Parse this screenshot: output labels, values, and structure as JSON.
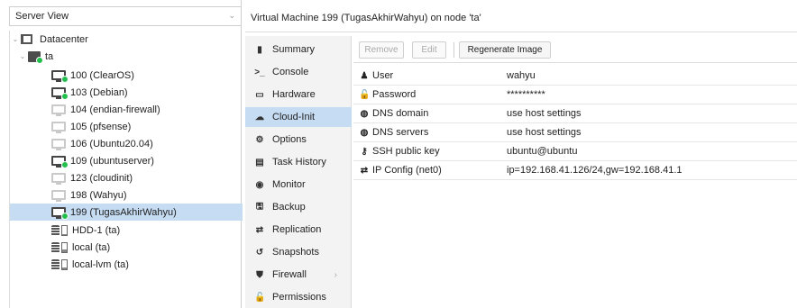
{
  "left": {
    "server_view": "Server View",
    "tree": [
      {
        "label": "Datacenter",
        "icon": "datacenter-icon"
      },
      {
        "label": "ta",
        "icon": "node-icon"
      },
      {
        "label": "100 (ClearOS)",
        "icon": "vm-running-icon"
      },
      {
        "label": "103 (Debian)",
        "icon": "vm-running-icon"
      },
      {
        "label": "104 (endian-firewall)",
        "icon": "vm-stopped-icon"
      },
      {
        "label": "105 (pfsense)",
        "icon": "vm-stopped-icon"
      },
      {
        "label": "106 (Ubuntu20.04)",
        "icon": "vm-stopped-icon"
      },
      {
        "label": "109 (ubuntuserver)",
        "icon": "vm-running-icon"
      },
      {
        "label": "123 (cloudinit)",
        "icon": "vm-stopped-icon"
      },
      {
        "label": "198 (Wahyu)",
        "icon": "vm-stopped-icon"
      },
      {
        "label": "199 (TugasAkhirWahyu)",
        "icon": "vm-running-icon"
      },
      {
        "label": "HDD-1 (ta)",
        "icon": "storage-icon"
      },
      {
        "label": "local (ta)",
        "icon": "storage-icon"
      },
      {
        "label": "local-lvm (ta)",
        "icon": "storage-icon"
      }
    ]
  },
  "header": {
    "title": "Virtual Machine 199 (TugasAkhirWahyu) on node 'ta'"
  },
  "menu": [
    {
      "label": "Summary",
      "icon": "book-icon",
      "glyph": "▮"
    },
    {
      "label": "Console",
      "icon": "terminal-icon",
      "glyph": ">_"
    },
    {
      "label": "Hardware",
      "icon": "monitor-icon",
      "glyph": "▭"
    },
    {
      "label": "Cloud-Init",
      "icon": "cloud-icon",
      "glyph": "☁"
    },
    {
      "label": "Options",
      "icon": "gear-icon",
      "glyph": "⚙"
    },
    {
      "label": "Task History",
      "icon": "list-icon",
      "glyph": "▤"
    },
    {
      "label": "Monitor",
      "icon": "eye-icon",
      "glyph": "◉"
    },
    {
      "label": "Backup",
      "icon": "floppy-icon",
      "glyph": "🖫"
    },
    {
      "label": "Replication",
      "icon": "retweet-icon",
      "glyph": "⇄"
    },
    {
      "label": "Snapshots",
      "icon": "history-icon",
      "glyph": "↺"
    },
    {
      "label": "Firewall",
      "icon": "shield-icon",
      "glyph": "⛊"
    },
    {
      "label": "Permissions",
      "icon": "unlock-icon",
      "glyph": "🔓"
    }
  ],
  "toolbar": {
    "remove_label": "Remove",
    "edit_label": "Edit",
    "regenerate_label": "Regenerate Image"
  },
  "rows": [
    {
      "key": "User",
      "value": "wahyu",
      "icon": "user-icon",
      "glyph": "♟"
    },
    {
      "key": "Password",
      "value": "**********",
      "icon": "unlock-icon",
      "glyph": "🔓"
    },
    {
      "key": "DNS domain",
      "value": "use host settings",
      "icon": "globe-icon",
      "glyph": "◍"
    },
    {
      "key": "DNS servers",
      "value": "use host settings",
      "icon": "globe-icon",
      "glyph": "◍"
    },
    {
      "key": "SSH public key",
      "value": "ubuntu@ubuntu",
      "icon": "key-icon",
      "glyph": "⚷"
    },
    {
      "key": "IP Config (net0)",
      "value": "ip=192.168.41.126/24,gw=192.168.41.1",
      "icon": "exchange-icon",
      "glyph": "⇄"
    }
  ]
}
